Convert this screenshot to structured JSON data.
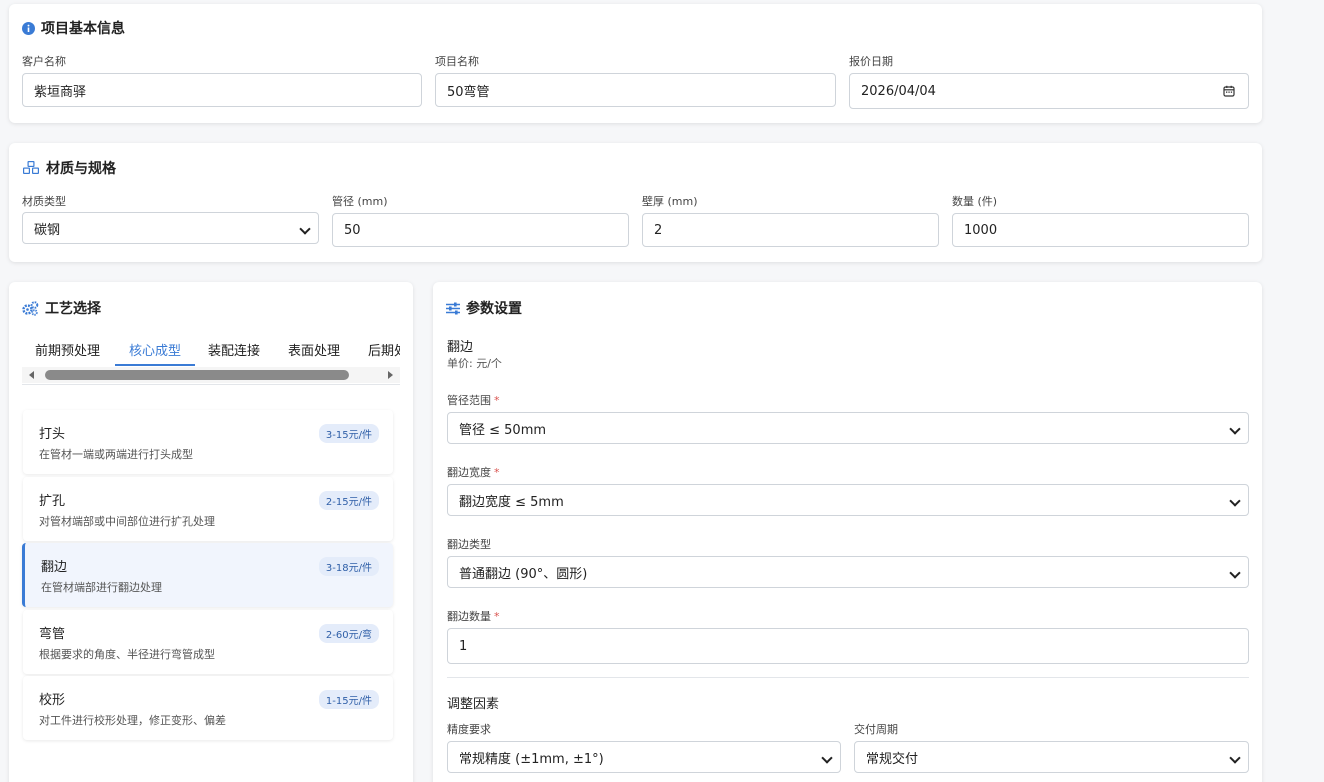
{
  "basic": {
    "title": "项目基本信息",
    "customer_label": "客户名称",
    "customer_value": "紫垣商驿",
    "project_label": "项目名称",
    "project_value": "50弯管",
    "date_label": "报价日期",
    "date_value": "2026/04/04"
  },
  "material": {
    "title": "材质与规格",
    "type_label": "材质类型",
    "type_value": "碳钢",
    "diameter_label": "管径 (mm)",
    "diameter_value": "50",
    "thickness_label": "壁厚 (mm)",
    "thickness_value": "2",
    "quantity_label": "数量 (件)",
    "quantity_value": "1000"
  },
  "process": {
    "title": "工艺选择",
    "tabs": [
      "前期预处理",
      "核心成型",
      "装配连接",
      "表面处理",
      "后期处理"
    ],
    "active_tab": "核心成型",
    "items": [
      {
        "name": "打头",
        "desc": "在管材一端或两端进行打头成型",
        "price": "3-15元/件"
      },
      {
        "name": "扩孔",
        "desc": "对管材端部或中间部位进行扩孔处理",
        "price": "2-15元/件"
      },
      {
        "name": "翻边",
        "desc": "在管材端部进行翻边处理",
        "price": "3-18元/件"
      },
      {
        "name": "弯管",
        "desc": "根据要求的角度、半径进行弯管成型",
        "price": "2-60元/弯"
      },
      {
        "name": "校形",
        "desc": "对工件进行校形处理，修正变形、偏差",
        "price": "1-15元/件"
      }
    ],
    "active_item": "翻边"
  },
  "params": {
    "title": "参数设置",
    "process_name": "翻边",
    "unit_price": "单价: 元/个",
    "range_label": "管径范围",
    "range_value": "管径 ≤ 50mm",
    "width_label": "翻边宽度",
    "width_value": "翻边宽度 ≤ 5mm",
    "type_label": "翻边类型",
    "type_value": "普通翻边 (90°、圆形)",
    "count_label": "翻边数量",
    "count_value": "1",
    "adjust_title": "调整因素",
    "precision_label": "精度要求",
    "precision_value": "常规精度 (±1mm, ±1°)",
    "delivery_label": "交付周期",
    "delivery_value": "常规交付",
    "required_mark": "*"
  },
  "colors": {
    "accent": "#3a7bd5",
    "required": "#d9534f",
    "badge_bg": "#e4ecfa"
  }
}
